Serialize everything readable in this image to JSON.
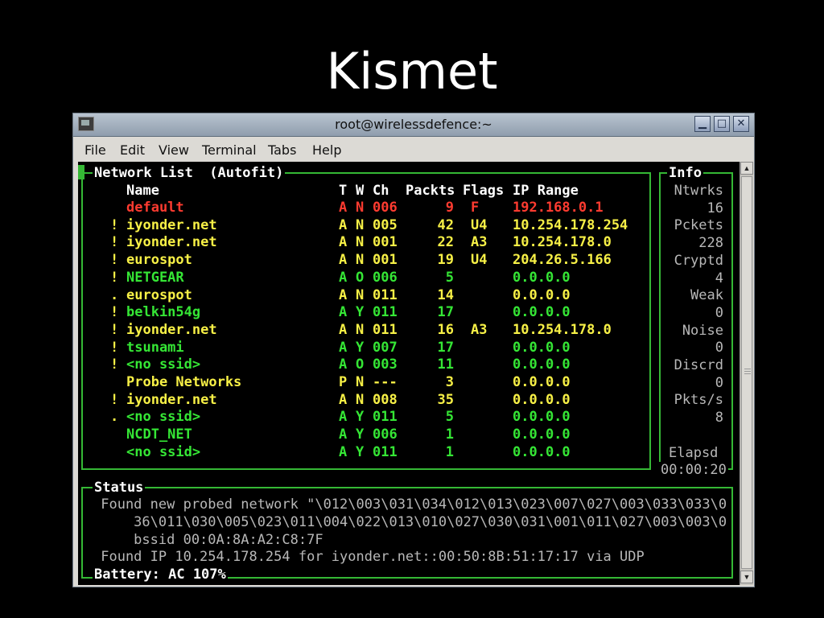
{
  "slide": {
    "title": "Kismet"
  },
  "window": {
    "title": "root@wirelessdefence:~",
    "buttons": {
      "minimize": "▁",
      "maximize": "□",
      "close": "✕"
    }
  },
  "menu": [
    "File",
    "Edit",
    "View",
    "Terminal",
    "Tabs",
    "Help"
  ],
  "network_list": {
    "label": "Network List  (Autofit)",
    "headers": {
      "name": "Name",
      "t": "T",
      "w": "W",
      "ch": "Ch",
      "packets": "Packts",
      "flags": "Flags",
      "ip": "IP Range"
    },
    "rows": [
      {
        "mark": "",
        "name": "default",
        "t": "A",
        "w": "N",
        "ch": "006",
        "packets": "9",
        "flags": "F",
        "ip": "192.168.0.1",
        "color": "red"
      },
      {
        "mark": "!",
        "name": "iyonder.net",
        "t": "A",
        "w": "N",
        "ch": "005",
        "packets": "42",
        "flags": "U4",
        "ip": "10.254.178.254",
        "color": "yellow"
      },
      {
        "mark": "!",
        "name": "iyonder.net",
        "t": "A",
        "w": "N",
        "ch": "001",
        "packets": "22",
        "flags": "A3",
        "ip": "10.254.178.0",
        "color": "yellow"
      },
      {
        "mark": "!",
        "name": "eurospot",
        "t": "A",
        "w": "N",
        "ch": "001",
        "packets": "19",
        "flags": "U4",
        "ip": "204.26.5.166",
        "color": "yellow"
      },
      {
        "mark": "!",
        "name": "NETGEAR",
        "t": "A",
        "w": "O",
        "ch": "006",
        "packets": "5",
        "flags": "",
        "ip": "0.0.0.0",
        "color": "green"
      },
      {
        "mark": ".",
        "name": "eurospot",
        "t": "A",
        "w": "N",
        "ch": "011",
        "packets": "14",
        "flags": "",
        "ip": "0.0.0.0",
        "color": "yellow"
      },
      {
        "mark": "!",
        "name": "belkin54g",
        "t": "A",
        "w": "Y",
        "ch": "011",
        "packets": "17",
        "flags": "",
        "ip": "0.0.0.0",
        "color": "green"
      },
      {
        "mark": "!",
        "name": "iyonder.net",
        "t": "A",
        "w": "N",
        "ch": "011",
        "packets": "16",
        "flags": "A3",
        "ip": "10.254.178.0",
        "color": "yellow"
      },
      {
        "mark": "!",
        "name": "tsunami",
        "t": "A",
        "w": "Y",
        "ch": "007",
        "packets": "17",
        "flags": "",
        "ip": "0.0.0.0",
        "color": "green"
      },
      {
        "mark": "!",
        "name": "<no ssid>",
        "t": "A",
        "w": "O",
        "ch": "003",
        "packets": "11",
        "flags": "",
        "ip": "0.0.0.0",
        "color": "green"
      },
      {
        "mark": "",
        "name": "Probe Networks",
        "t": "P",
        "w": "N",
        "ch": "---",
        "packets": "3",
        "flags": "",
        "ip": "0.0.0.0",
        "color": "yellow"
      },
      {
        "mark": "!",
        "name": "iyonder.net",
        "t": "A",
        "w": "N",
        "ch": "008",
        "packets": "35",
        "flags": "",
        "ip": "0.0.0.0",
        "color": "yellow"
      },
      {
        "mark": ".",
        "name": "<no ssid>",
        "t": "A",
        "w": "Y",
        "ch": "011",
        "packets": "5",
        "flags": "",
        "ip": "0.0.0.0",
        "color": "green"
      },
      {
        "mark": "",
        "name": "NCDT_NET",
        "t": "A",
        "w": "Y",
        "ch": "006",
        "packets": "1",
        "flags": "",
        "ip": "0.0.0.0",
        "color": "green"
      },
      {
        "mark": "",
        "name": "<no ssid>",
        "t": "A",
        "w": "Y",
        "ch": "011",
        "packets": "1",
        "flags": "",
        "ip": "0.0.0.0",
        "color": "green"
      }
    ]
  },
  "info": {
    "label": "Info",
    "entries": [
      {
        "label": "Ntwrks",
        "value": "16"
      },
      {
        "label": "Pckets",
        "value": "228"
      },
      {
        "label": "Cryptd",
        "value": "4"
      },
      {
        "label": "Weak",
        "value": "0"
      },
      {
        "label": "Noise",
        "value": "0"
      },
      {
        "label": "Discrd",
        "value": "0"
      },
      {
        "label": "Pkts/s",
        "value": "8"
      }
    ],
    "elapsed_label": "Elapsd",
    "elapsed_value": "00:00:20"
  },
  "status": {
    "label": "Status",
    "lines": [
      " Found new probed network \"\\012\\003\\031\\034\\012\\013\\023\\007\\027\\003\\033\\033\\0",
      "     36\\011\\030\\005\\023\\011\\004\\022\\013\\010\\027\\030\\031\\001\\011\\027\\003\\003\\0",
      "     bssid 00:0A:8A:A2:C8:7F",
      " Found IP 10.254.178.254 for iyonder.net::00:50:8B:51:17:17 via UDP"
    ],
    "battery": "Battery: AC 107%"
  },
  "colors": {
    "red": "#ff3b30",
    "yellow": "#f7f046",
    "green": "#35e635",
    "frame": "#35b835"
  }
}
